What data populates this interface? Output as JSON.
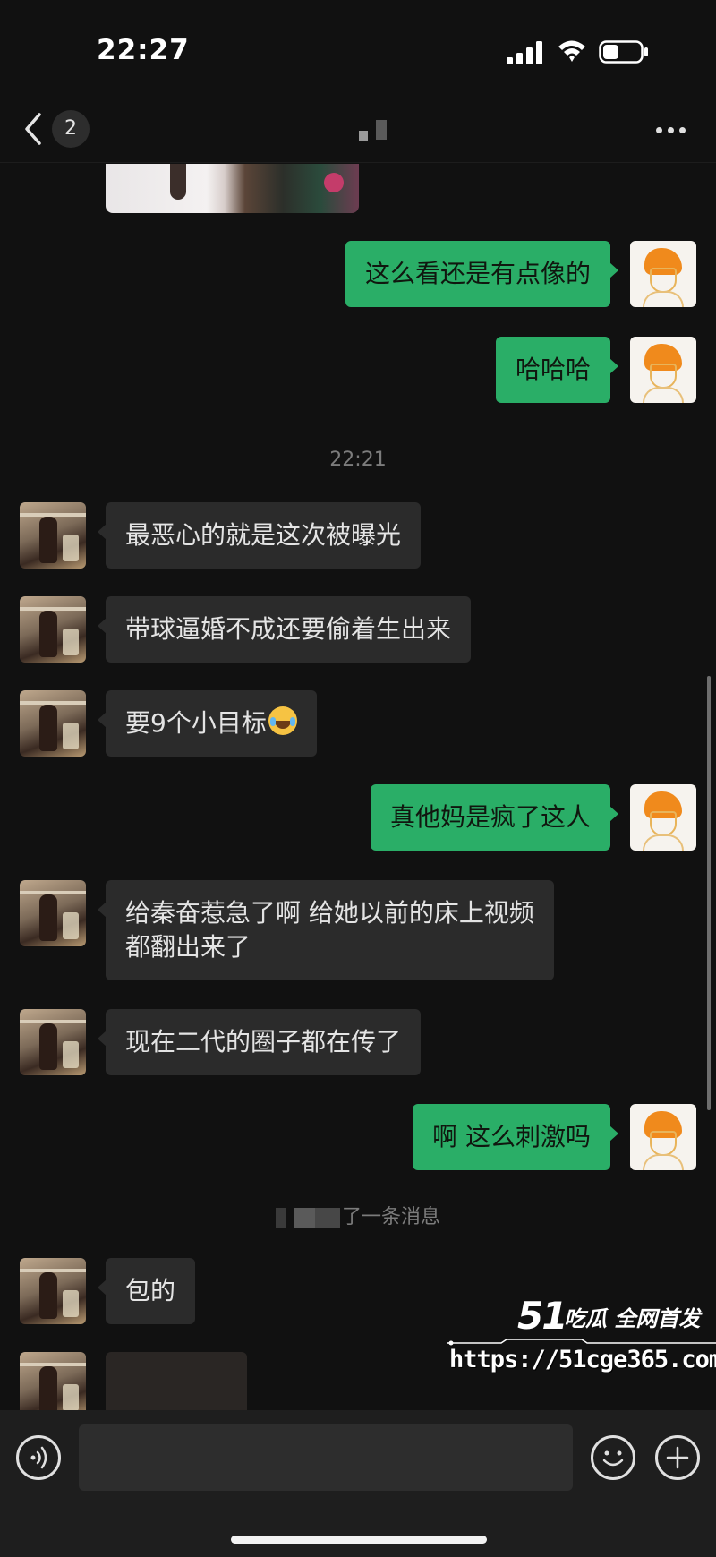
{
  "status_bar": {
    "time": "22:27"
  },
  "nav": {
    "unread_count": "2"
  },
  "messages": [
    {
      "side": "out",
      "text": "这么看还是有点像的"
    },
    {
      "side": "out",
      "text": "哈哈哈"
    },
    {
      "type": "timestamp",
      "text": "22:21"
    },
    {
      "side": "in",
      "text": "最恶心的就是这次被曝光"
    },
    {
      "side": "in",
      "text": "带球逼婚不成还要偷着生出来"
    },
    {
      "side": "in",
      "text": "要9个小目标",
      "emoji": "tears-of-joy-emoji"
    },
    {
      "side": "out",
      "text": "真他妈是疯了这人"
    },
    {
      "side": "in",
      "lines": [
        "给秦奋惹急了啊 给她以前的床上视频",
        "都翻出来了"
      ]
    },
    {
      "side": "in",
      "text": "现在二代的圈子都在传了"
    },
    {
      "side": "out",
      "text": "啊 这么刺激吗"
    },
    {
      "type": "system",
      "text": "了一条消息"
    },
    {
      "side": "in",
      "text": "包的"
    }
  ],
  "watermark": {
    "logo": "51",
    "slogan": "吃瓜 全网首发",
    "url": "https://51cge365.com"
  },
  "icons": {
    "back": "chevron-left-icon",
    "more": "more-dots-icon",
    "voice": "voice-icon",
    "emoji": "smiley-icon",
    "plus": "plus-icon"
  }
}
